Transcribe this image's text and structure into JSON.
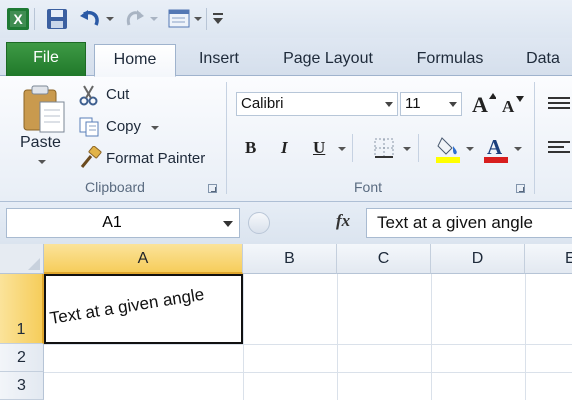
{
  "quick_access": {
    "icons": [
      "excel-logo-icon",
      "save-icon",
      "undo-icon",
      "redo-icon",
      "customize-icon"
    ]
  },
  "tabs": [
    {
      "label": "File",
      "active": false
    },
    {
      "label": "Home",
      "active": true
    },
    {
      "label": "Insert",
      "active": false
    },
    {
      "label": "Page Layout",
      "active": false
    },
    {
      "label": "Formulas",
      "active": false
    },
    {
      "label": "Data",
      "active": false
    }
  ],
  "ribbon": {
    "clipboard": {
      "paste_label": "Paste",
      "cut_label": "Cut",
      "copy_label": "Copy",
      "format_painter_label": "Format Painter",
      "group_label": "Clipboard"
    },
    "font": {
      "font_name": "Calibri",
      "font_size": "11",
      "bold_label": "B",
      "italic_label": "I",
      "underline_label": "U",
      "group_label": "Font",
      "highlight_color": "#ffff00",
      "font_color": "#d81e1e"
    }
  },
  "formula_bar": {
    "name_box": "A1",
    "fx_label": "fx",
    "formula": "Text at a given angle"
  },
  "grid": {
    "columns": [
      "A",
      "B",
      "C",
      "D",
      "E"
    ],
    "rows": [
      "1",
      "2",
      "3"
    ],
    "selected_column": "A",
    "selected_row": "1",
    "cell_a1": "Text at a given angle",
    "cell_a1_rotation_deg": 9
  }
}
